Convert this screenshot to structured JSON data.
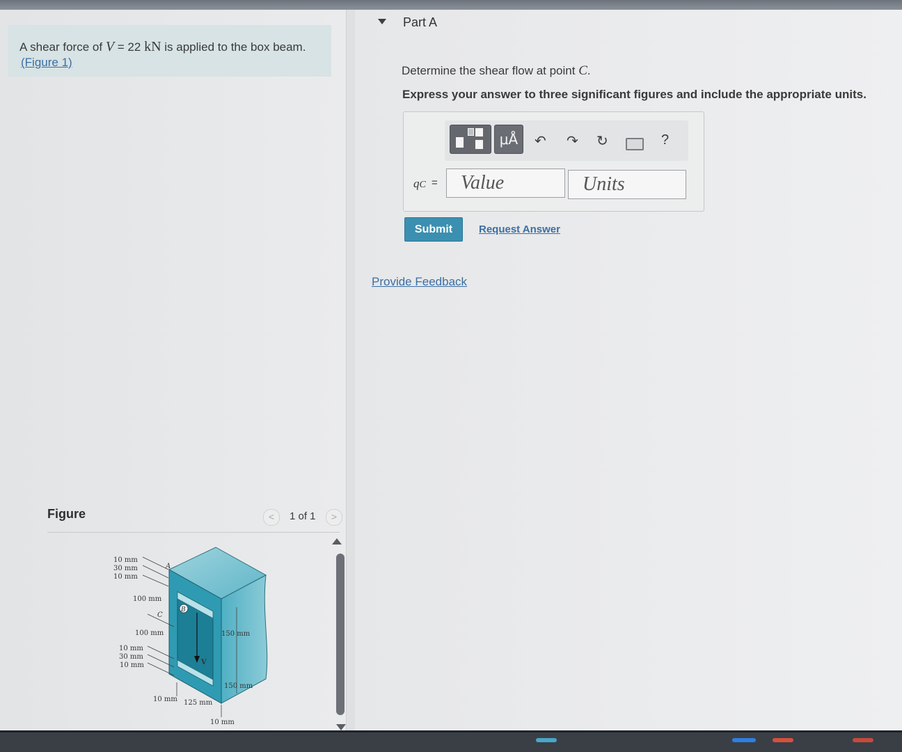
{
  "problem": {
    "prompt_prefix": "A shear force of",
    "variable": "V",
    "equals": "= 22",
    "unit": "kN",
    "prompt_suffix": "is applied to the box beam.",
    "figure_link": "(Figure 1)"
  },
  "figure_panel": {
    "label": "Figure",
    "pager": "1 of 1",
    "prev_glyph": "<",
    "next_glyph": ">",
    "diagram_labels": {
      "t1": "10 mm",
      "t2": "30 mm",
      "t3": "10 mm",
      "h1": "100 mm",
      "h2": "100 mm",
      "b1": "10 mm",
      "b2": "30 mm",
      "b3": "10 mm",
      "w1": "10 mm",
      "w2": "125 mm",
      "w3": "10 mm",
      "d1": "150 mm",
      "d2": "150 mm",
      "point_a": "A",
      "point_b": "B",
      "point_c": "C",
      "force": "V"
    }
  },
  "part": {
    "title": "Part A",
    "question_prefix": "Determine the shear flow at point",
    "question_point": "C",
    "question_suffix": ".",
    "instruction": "Express your answer to three significant figures and include the appropriate units."
  },
  "answer": {
    "label_var": "q",
    "label_sub": "C",
    "label_eq": "=",
    "value_placeholder": "Value",
    "units_placeholder": "Units",
    "toolbar_units_glyph": "μÅ",
    "undo_glyph": "↶",
    "redo_glyph": "↷",
    "reset_glyph": "↻",
    "help_glyph": "?"
  },
  "actions": {
    "submit": "Submit",
    "request_answer": "Request Answer",
    "provide_feedback": "Provide Feedback"
  },
  "colors": {
    "accent": "#3b8fb0",
    "link": "#3c6fa3",
    "beam": "#3aa3b8"
  }
}
